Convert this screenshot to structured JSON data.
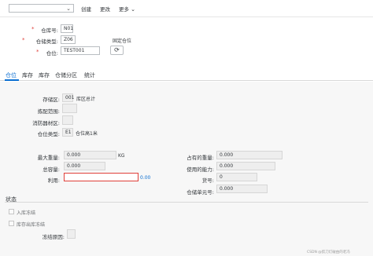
{
  "toolbar": {
    "select_value": "",
    "create_label": "创建",
    "change_label": "更改",
    "more_label": "更多",
    "more_chevron": "chevron-down-icon"
  },
  "header": {
    "warehouse_no_label": "仓库号:",
    "warehouse_no_value": "N01",
    "storage_type_label": "仓储类型:",
    "storage_type_value": "Z06",
    "fixed_bin_label": "固定仓位",
    "bin_label": "仓位:",
    "bin_value": "TEST001",
    "refresh_icon": "refresh-icon"
  },
  "tabs": [
    {
      "label": "仓位",
      "active": true
    },
    {
      "label": "库存",
      "active": false
    },
    {
      "label": "库存",
      "active": false
    },
    {
      "label": "仓储分区",
      "active": false
    },
    {
      "label": "统计",
      "active": false
    }
  ],
  "details": {
    "storage_section_label": "存储区:",
    "storage_section_value": "001",
    "storage_section_desc": "库区总计",
    "picking_area_label": "拣配范围:",
    "picking_area_value": "",
    "fire_area_label": "消防器材区:",
    "fire_area_value": "",
    "bin_type_label": "仓位类型:",
    "bin_type_value": "E1",
    "bin_type_desc": "仓位高1米",
    "max_weight_label": "最大重量:",
    "max_weight_value": "0.000",
    "max_weight_unit": "KG",
    "total_capacity_label": "总容量:",
    "total_capacity_value": "0.000",
    "utilization_label": "利用:",
    "utilization_value": "",
    "utilization_percent": "0.00",
    "occupied_weight_label": "占有的重量:",
    "occupied_weight_value": "0.000",
    "used_capacity_label": "使用的能力:",
    "used_capacity_value": "0.000",
    "shelf_no_label": "货号:",
    "shelf_no_value": "0",
    "storage_unit_label": "仓储单元号:",
    "storage_unit_value": "0.000"
  },
  "status": {
    "title": "状态",
    "inbound_block_label": "入库冻结",
    "outbound_block_label": "库存出库冻结",
    "block_reason_label": "冻结原因:",
    "block_reason_value": ""
  },
  "watermark": "CSDN @剪刀灯破由的老冯"
}
